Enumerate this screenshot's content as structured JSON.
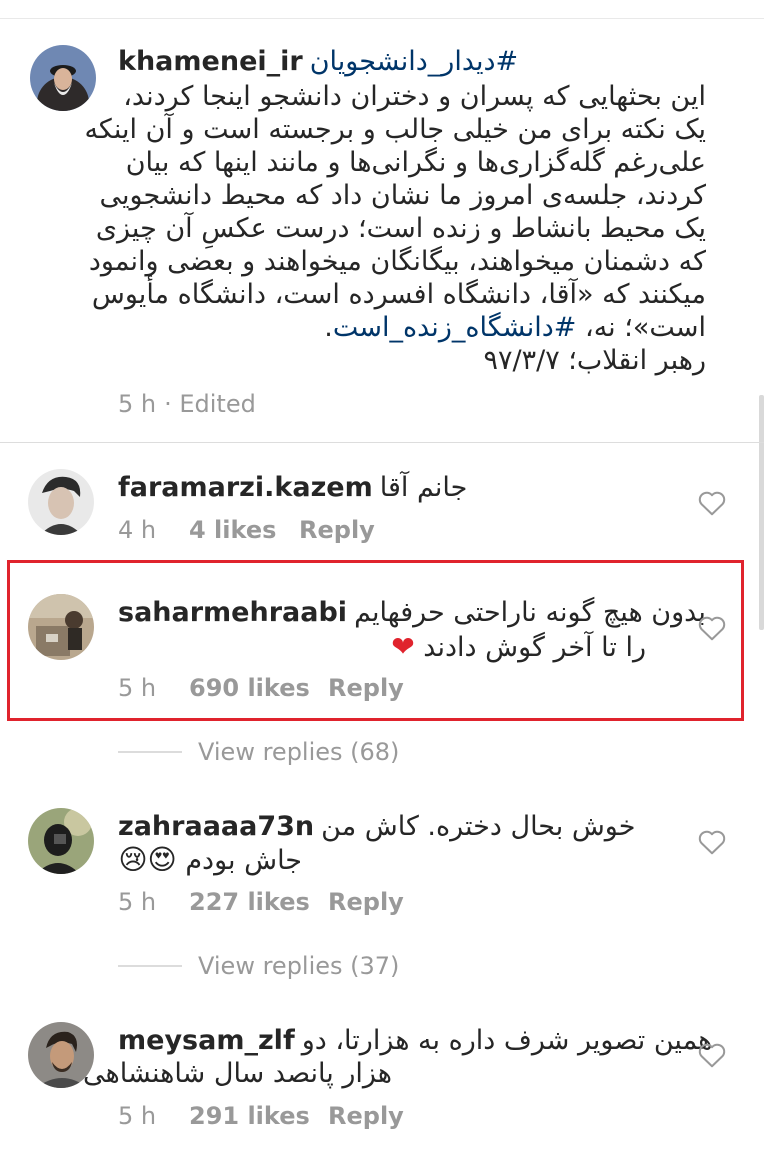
{
  "post": {
    "username": "khamenei_ir",
    "hashtag": "#دیدار_دانشجویان",
    "caption_lines": [
      "این بحثهایی که پسران و دختران دانشجو اینجا کردند،",
      "یک نکته برای من خیلی جالب و برجسته است و آن اینکه",
      "علی‌رغم گله‌گزاری‌ها و نگرانی‌ها و مانند اینها که بیان",
      "کردند، جلسه‌ی امروز ما نشان داد که محیط دانشجویی",
      "یک محیط بانشاط و زنده است؛ درست عکسِ آن چیزی",
      "که دشمنان میخواهند، بیگانگان میخواهند و بعضی وانمود",
      "میکنند که «آقا، دانشگاه افسرده است، دانشگاه مأیوس"
    ],
    "caption_line8_prefix": "است»؛ نه، ",
    "caption_line8_tag": "#دانشگاه_زنده_است",
    "caption_line8_suffix": ".",
    "caption_signature": "رهبر انقلاب؛ ۹۷/۳/۷",
    "time": "5 h",
    "edited": "· Edited"
  },
  "comments": [
    {
      "username": "faramarzi.kazem",
      "line1": "جانم آقا",
      "time": "4 h",
      "likes": "4 likes",
      "reply": "Reply"
    },
    {
      "username": "saharmehraabi",
      "line1": "بدون هیچ گونه ناراحتی حرفهایم",
      "line2": "را تا آخر گوش دادند",
      "emoji": "❤",
      "time": "5 h",
      "likes": "690 likes",
      "reply": "Reply",
      "view_replies": "View replies (68)"
    },
    {
      "username": "zahraaaa73n",
      "line1": "خوش بحال دختره. کاش من",
      "line2": "جاش بودم",
      "emoji": "😍😢",
      "time": "5 h",
      "likes": "227 likes",
      "reply": "Reply",
      "view_replies": "View replies (37)"
    },
    {
      "username": "meysam_zlf",
      "line1": "همین تصویر شرف داره به هزارتا، دو",
      "line2": "هزار پانصد سال شاهنشاهی",
      "time": "5 h",
      "likes": "291 likes",
      "reply": "Reply"
    }
  ]
}
